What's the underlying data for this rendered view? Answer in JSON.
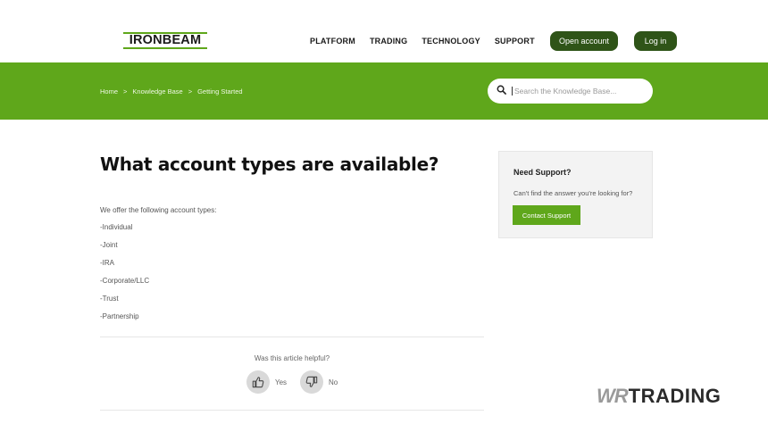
{
  "header": {
    "logo_text": "IRONBEAM",
    "nav": [
      {
        "label": "PLATFORM"
      },
      {
        "label": "TRADING"
      },
      {
        "label": "TECHNOLOGY"
      },
      {
        "label": "SUPPORT"
      }
    ],
    "open_account_label": "Open account",
    "login_label": "Log in"
  },
  "breadcrumb": {
    "items": [
      "Home",
      "Knowledge Base",
      "Getting Started"
    ],
    "separator": ">"
  },
  "search": {
    "placeholder": "Search the Knowledge Base..."
  },
  "article": {
    "title": "What account types are available?",
    "intro": "We offer the following account types:",
    "types": [
      "-Individual",
      "-Joint",
      "-IRA",
      "-Corporate/LLC",
      "-Trust",
      "-Partnership"
    ],
    "helpful_prompt": "Was this article helpful?",
    "yes_label": "Yes",
    "no_label": "No"
  },
  "sidebar": {
    "heading": "Need Support?",
    "text": "Can't find the answer you're looking for?",
    "button_label": "Contact Support"
  },
  "watermark": {
    "part1": "WR",
    "part2": "TRADING"
  },
  "colors": {
    "brand_green": "#5fa71b",
    "dark_green_button": "#2f5418"
  }
}
